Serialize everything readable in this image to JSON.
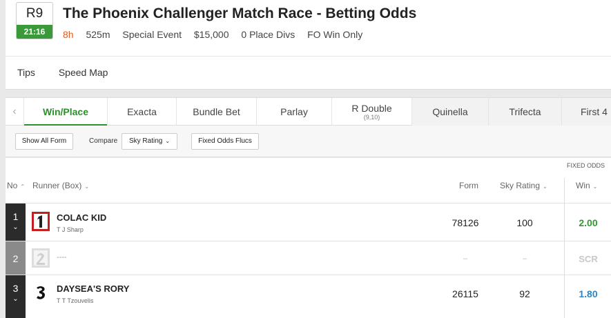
{
  "race": {
    "number": "R9",
    "time": "21:16",
    "title": "The Phoenix Challenger Match Race - Betting Odds",
    "countdown": "8h",
    "distance": "525m",
    "event_type": "Special Event",
    "prize": "$15,000",
    "place_divs": "0 Place Divs",
    "fo_note": "FO Win Only"
  },
  "subnav": [
    "Tips",
    "Speed Map"
  ],
  "tabs": [
    {
      "label": "Win/Place",
      "active": true
    },
    {
      "label": "Exacta"
    },
    {
      "label": "Bundle Bet"
    },
    {
      "label": "Parlay"
    },
    {
      "label": "R Double",
      "sub": "(9,10)"
    },
    {
      "label": "Quinella"
    },
    {
      "label": "Trifecta"
    },
    {
      "label": "First 4"
    }
  ],
  "filters": {
    "show_all_form": "Show All Form",
    "compare_label": "Compare",
    "compare_value": "Sky Rating",
    "fixed_odds_flucs": "Fixed Odds Flucs"
  },
  "table": {
    "fixed_odds_label": "FIXED ODDS",
    "headers": {
      "no": "No",
      "runner": "Runner (Box)",
      "form": "Form",
      "rating": "Sky Rating",
      "win": "Win"
    },
    "rows": [
      {
        "no": "1",
        "name": "COLAC KID",
        "trainer": "T J Sharp",
        "form": "78126",
        "rating": "100",
        "win": "2.00",
        "silk": "1"
      },
      {
        "no": "2",
        "name": "",
        "trainer": "----",
        "form": "–",
        "rating": "–",
        "win": "SCR",
        "silk": "2",
        "scratched": true
      },
      {
        "no": "3",
        "name": "DAYSEA'S RORY",
        "trainer": "T T Tzouvelis",
        "form": "26115",
        "rating": "92",
        "win": "1.80",
        "silk": "3"
      }
    ]
  },
  "colors": {
    "brand_green": "#2c8f2c",
    "countdown_orange": "#e05a1c",
    "odds_green": "#2e9a2e",
    "odds_blue": "#2a86c8"
  }
}
